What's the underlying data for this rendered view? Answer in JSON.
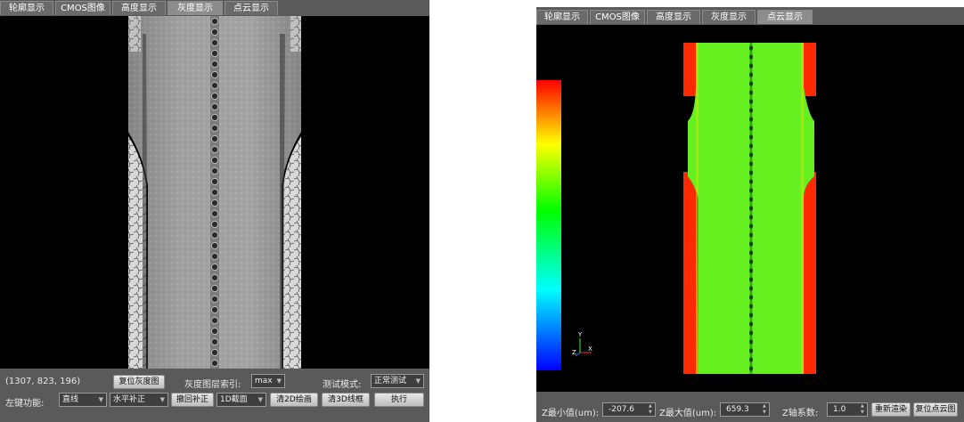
{
  "tabs": [
    "轮廓显示",
    "CMOS图像",
    "高度显示",
    "灰度显示",
    "点云显示"
  ],
  "left": {
    "active_tab": 3,
    "coord_readout": "(1307,  823,  196)",
    "reset_gray_button": "复位灰度图",
    "gray_layer_index_label": "灰度图层索引:",
    "gray_layer_index_value": "max",
    "test_mode_label": "测试模式:",
    "test_mode_value": "正常测试",
    "left_key_label": "左键功能:",
    "left_key_value": "直线",
    "compensation_value": "水平补正",
    "undo_compensation_button": "撤回补正",
    "section_value": "1D截面",
    "clear_2d_button": "清2D绘画",
    "clear_3d_button": "清3D线框",
    "execute_button": "执行"
  },
  "right": {
    "active_tab": 4,
    "z_min_label": "Z最小值(um):",
    "z_min_value": "-207.6",
    "z_max_label": "Z最大值(um):",
    "z_max_value": "659.3",
    "z_axis_factor_label": "Z轴系数:",
    "z_axis_factor_value": "1.0",
    "rerender_button": "重新渲染",
    "reset_cloud_button": "复位点云图",
    "axis_labels": {
      "y": "Y",
      "z": "Z",
      "x": "X"
    }
  },
  "colors": {
    "panel_bg": "#5a5a5a",
    "view_bg": "#000000",
    "cloud_green": "#66f020",
    "cloud_red": "#ff2a00"
  }
}
